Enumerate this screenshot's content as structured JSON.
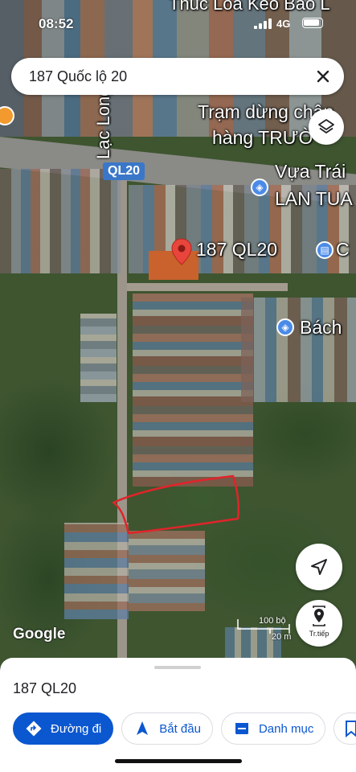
{
  "status_bar": {
    "time": "08:52",
    "network": "4G"
  },
  "search": {
    "query": "187 Quốc lộ 20"
  },
  "map": {
    "labels": {
      "top_place": "Thúc Loa Kéo Bảo L",
      "street_vertical": "Lạc Long Q",
      "poi_1_line1": "Trạm dừng chân",
      "poi_1_line2": "hàng TRƯỜ",
      "poi_2_line1": "Vựa Trái",
      "poi_2_line2": "LAN TUA",
      "selected_place": "187 QL20",
      "poi_3": "C",
      "poi_4": "Bách"
    },
    "route_shield": "QL20",
    "scale": {
      "imperial": "100 bộ",
      "metric": "20 m"
    },
    "attribution": "Google",
    "next_button_label": "Tr.tiếp",
    "colors": {
      "boundary_outline": "#e0242a",
      "pin": "#e8453c",
      "poi_blue": "#4b8be8"
    }
  },
  "sheet": {
    "title": "187 QL20",
    "actions": [
      {
        "label": "Đường đi",
        "icon": "directions-icon"
      },
      {
        "label": "Bắt đầu",
        "icon": "navigation-arrow-icon"
      },
      {
        "label": "Danh mục",
        "icon": "save-list-icon"
      },
      {
        "label": "",
        "icon": "bookmark-icon"
      }
    ]
  }
}
